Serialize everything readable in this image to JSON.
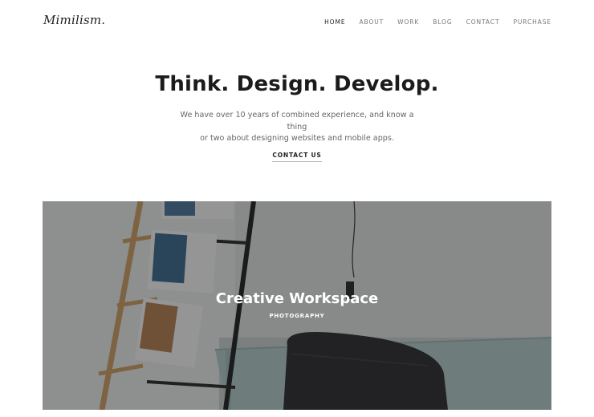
{
  "header": {
    "logo": "Mimilism.",
    "nav": [
      "HOME",
      "ABOUT",
      "WORK",
      "BLOG",
      "CONTACT",
      "PURCHASE"
    ],
    "active_nav": "HOME"
  },
  "hero": {
    "title": "Think. Design. Develop.",
    "text_line1": "We have over 10 years of combined experience, and know a thing",
    "text_line2": "or two about designing websites and mobile apps.",
    "cta": "CONTACT US"
  },
  "feature": {
    "title": "Creative Workspace",
    "category": "PHOTOGRAPHY",
    "image": "workspace-photo"
  }
}
